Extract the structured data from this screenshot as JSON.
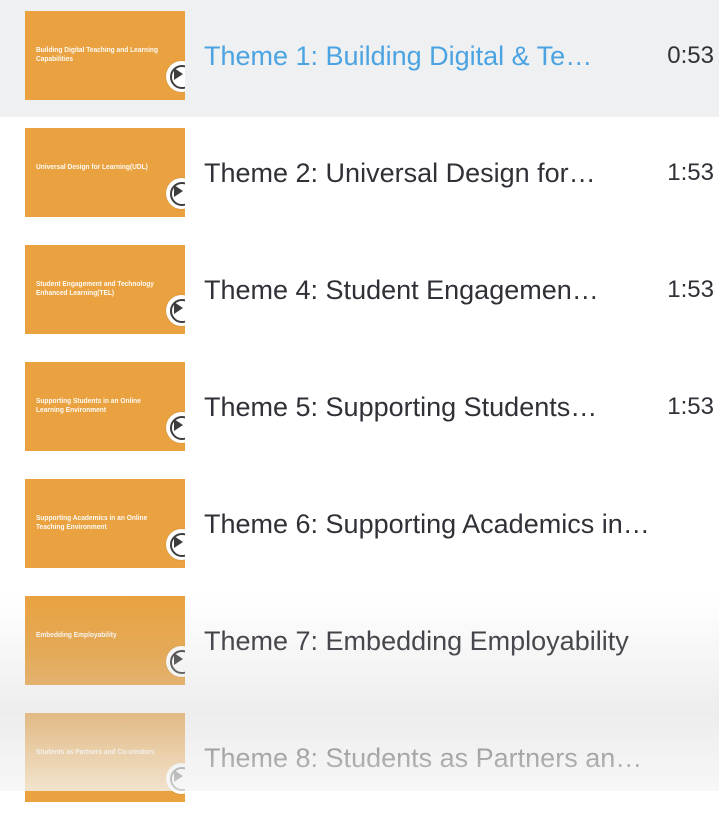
{
  "playlist": {
    "items": [
      {
        "thumb_text": "Building Digital Teaching and Learning Capabilities",
        "title": "Theme 1: Building Digital & Te…",
        "duration": "0:53",
        "active": true
      },
      {
        "thumb_text": "Universal Design for Learning(UDL)",
        "title": "Theme 2: Universal Design for…",
        "duration": "1:53",
        "active": false
      },
      {
        "thumb_text": "Student Engagement and Technology Enhanced Learning(TEL)",
        "title": "Theme 4: Student Engagemen…",
        "duration": "1:53",
        "active": false
      },
      {
        "thumb_text": "Supporting Students in an Online Learning Environment",
        "title": "Theme 5: Supporting Students…",
        "duration": "1:53",
        "active": false
      },
      {
        "thumb_text": "Supporting Academics in an Online Teaching Environment",
        "title": "Theme 6: Supporting Academics in…",
        "duration": "",
        "active": false
      },
      {
        "thumb_text": "Embedding Employability",
        "title": "Theme 7: Embedding Employability",
        "duration": "",
        "active": false
      },
      {
        "thumb_text": "Students as Partners and Co-creators",
        "title": "Theme 8: Students as Partners an…",
        "duration": "",
        "active": false
      }
    ]
  },
  "colors": {
    "active_title": "#4ba3e1",
    "text": "#2f3137",
    "thumbnail": "#e9a23f",
    "active_row_bg": "#eef0f2"
  }
}
